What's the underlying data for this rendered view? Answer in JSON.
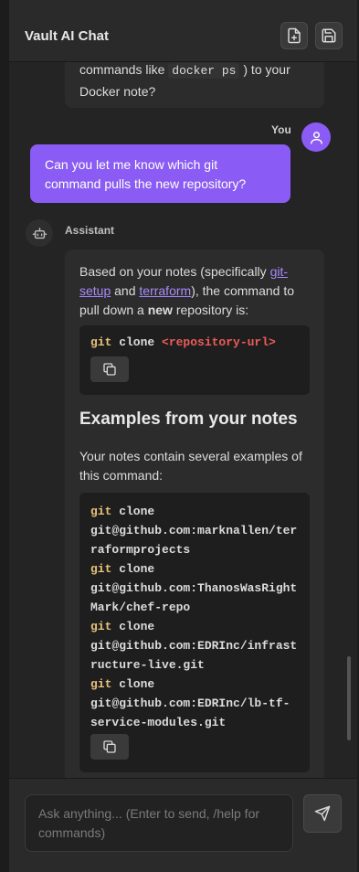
{
  "header": {
    "title": "Vault AI Chat",
    "new_file_icon": "file-plus-icon",
    "save_icon": "save-icon"
  },
  "messages": {
    "previous": {
      "line1_prefix": "commands like ",
      "line1_code": "docker ps",
      "line1_suffix": " ) to your",
      "line2": "Docker note?"
    },
    "user": {
      "label": "You",
      "text": "Can you let me know which git command pulls the new repository?"
    },
    "assistant": {
      "label": "Assistant",
      "intro_1": "Based on your notes (specifically ",
      "link_1": "git-setup",
      "intro_2": " and ",
      "link_2": "terraform",
      "intro_3": "), the command to pull down a ",
      "bold": "new",
      "intro_4": " repository is:",
      "code1_keyword": "git",
      "code1_text": " clone ",
      "code1_arg": "<repository-url>",
      "heading": "Examples from your notes",
      "para": "Your notes contain several examples of this command:",
      "code2_lines": [
        {
          "kw": "git",
          "text": " clone"
        },
        {
          "kw": "",
          "text": "git@github.com:marknallen/ter"
        },
        {
          "kw": "",
          "text": "raformprojects"
        },
        {
          "kw": "git",
          "text": " clone"
        },
        {
          "kw": "",
          "text": "git@github.com:ThanosWasRight"
        },
        {
          "kw": "",
          "text": "Mark/chef-repo"
        },
        {
          "kw": "git",
          "text": " clone"
        },
        {
          "kw": "",
          "text": "git@github.com:EDRInc/infrast"
        },
        {
          "kw": "",
          "text": "ructure-live.git"
        },
        {
          "kw": "git",
          "text": " clone"
        },
        {
          "kw": "",
          "text": "git@github.com:EDRInc/lb-tf-"
        },
        {
          "kw": "",
          "text": "service-modules.git"
        }
      ]
    }
  },
  "footer": {
    "placeholder": "Ask anything... (Enter to send, /help for commands)",
    "send_icon": "send-icon"
  },
  "colors": {
    "accent": "#8a5cf5",
    "link": "#a78bfa",
    "keyword": "#e5c07b",
    "string": "#ef5a5a"
  }
}
